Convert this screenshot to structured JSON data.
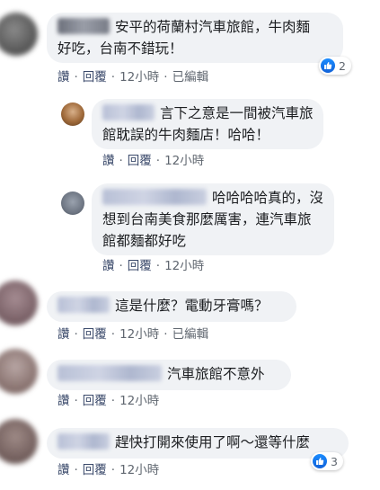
{
  "comments": [
    {
      "text_line1": "安平的荷蘭村汽車旅館，牛肉麵",
      "text_line2": "好吃，台南不錯玩！",
      "actions": {
        "like": "讚",
        "reply": "回覆",
        "time": "12小時",
        "edited": "已編輯"
      },
      "reactions": "2"
    },
    {
      "text_line1": "言下之意是一間被汽車旅",
      "text_line2": "館耽誤的牛肉麵店！哈哈！",
      "actions": {
        "like": "讚",
        "reply": "回覆",
        "time": "12小時"
      }
    },
    {
      "text_line1": "哈哈哈哈真的，沒",
      "text_line2": "想到台南美食那麼厲害，連汽車旅",
      "text_line3": "館都麵都好吃",
      "actions": {
        "like": "讚",
        "reply": "回覆",
        "time": "12小時"
      }
    },
    {
      "text_line1": "這是什麼？電動牙膏嗎？",
      "actions": {
        "like": "讚",
        "reply": "回覆",
        "time": "12小時",
        "edited": "已編輯"
      }
    },
    {
      "text_line1": "汽車旅館不意外",
      "actions": {
        "like": "讚",
        "reply": "回覆",
        "time": "12小時"
      }
    },
    {
      "text_line1": "趕快打開來使用了啊～還等什麼",
      "actions": {
        "like": "讚",
        "reply": "回覆",
        "time": "12小時"
      },
      "reactions": "3"
    }
  ],
  "colors": {
    "bubble": "#f0f2f5",
    "like_blue": "#1877f2",
    "meta_text": "#606770"
  },
  "icons": [
    "like-icon"
  ]
}
